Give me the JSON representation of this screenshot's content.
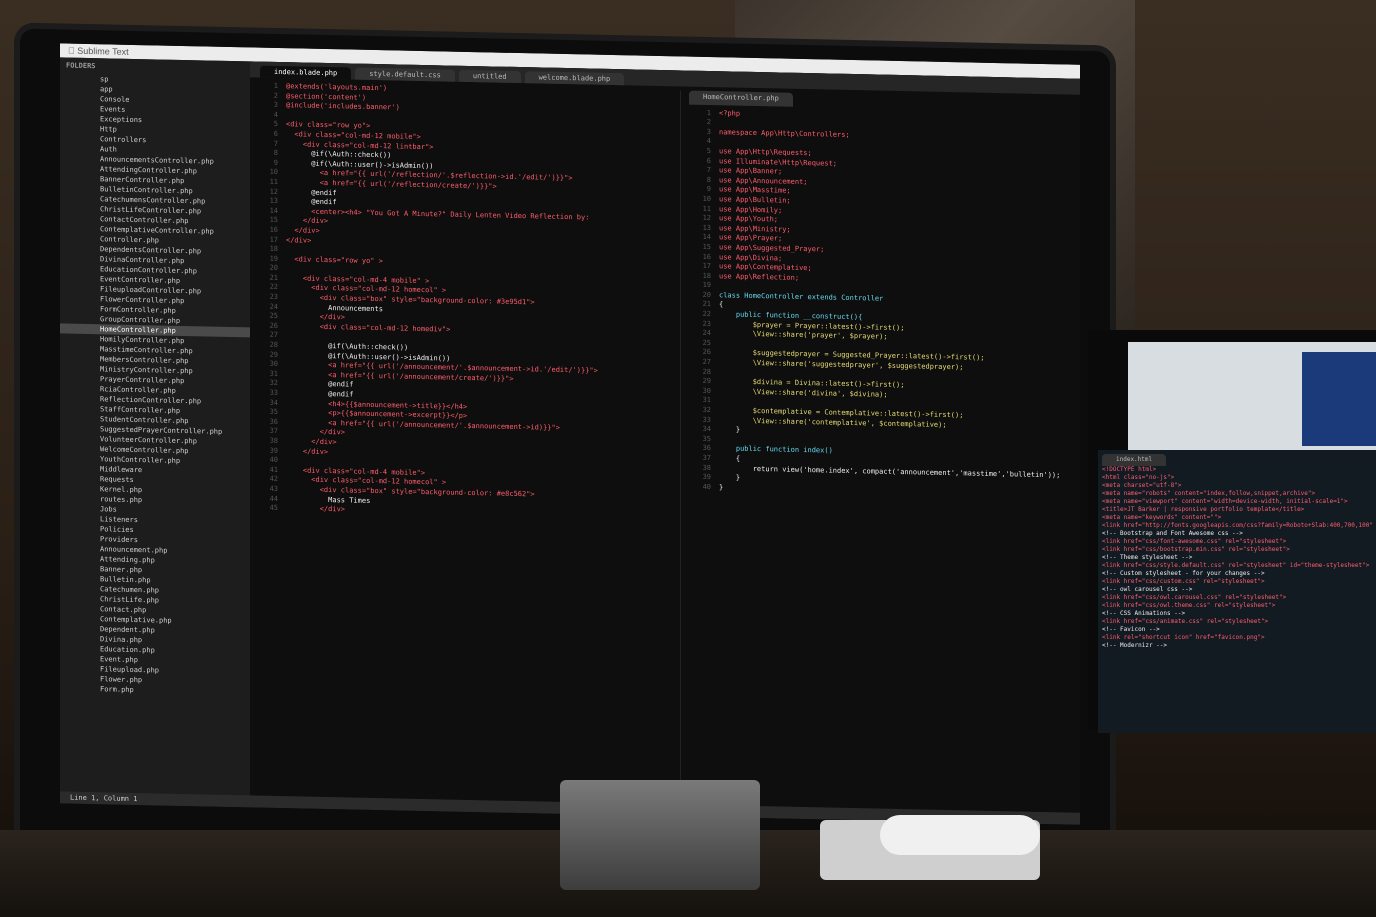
{
  "app": {
    "name": "Sublime Text",
    "menubar_label": "Sublime Text",
    "sidebar_header": "FOLDERS",
    "sidebar_items": [
      "sp",
      "app",
      "Console",
      "Events",
      "Exceptions",
      "Http",
      "Controllers",
      "Auth",
      "AnnouncementsController.php",
      "AttendingController.php",
      "BannerController.php",
      "BulletinController.php",
      "CatechumensController.php",
      "ChristLifeController.php",
      "ContactController.php",
      "ContemplativeController.php",
      "Controller.php",
      "DependentsController.php",
      "DivinaController.php",
      "EducationController.php",
      "EventController.php",
      "FileuploadController.php",
      "FlowerController.php",
      "FormController.php",
      "GroupController.php",
      "HomeController.php",
      "HomilyController.php",
      "MasstimeController.php",
      "MembersController.php",
      "MinistryController.php",
      "PrayerController.php",
      "RciaController.php",
      "ReflectionController.php",
      "StaffController.php",
      "StudentController.php",
      "SuggestedPrayerController.php",
      "VolunteerController.php",
      "WelcomeController.php",
      "YouthController.php",
      "Middleware",
      "Requests",
      "Kernel.php",
      "routes.php",
      "Jobs",
      "Listeners",
      "Policies",
      "Providers",
      "Announcement.php",
      "Attending.php",
      "Banner.php",
      "Bulletin.php",
      "Catechumen.php",
      "ChristLife.php",
      "Contact.php",
      "Contemplative.php",
      "Dependent.php",
      "Divina.php",
      "Education.php",
      "Event.php",
      "Fileupload.php",
      "Flower.php",
      "Form.php"
    ],
    "selected_sidebar_item": "HomeController.php",
    "tabs": [
      "index.blade.php",
      "style.default.css",
      "untitled",
      "welcome.blade.php"
    ],
    "active_tab": "index.blade.php",
    "secondary_tab": "HomeController.php",
    "status_text": "Line 1, Column 1"
  },
  "code_left": [
    {
      "n": "1",
      "text": "@extends('layouts.main')"
    },
    {
      "n": "2",
      "text": "@section('content')"
    },
    {
      "n": "3",
      "text": "@include('includes.banner')"
    },
    {
      "n": "4",
      "text": ""
    },
    {
      "n": "5",
      "text": "<div class=\"row yo\">"
    },
    {
      "n": "6",
      "text": "  <div class=\"col-md-12 mobile\">"
    },
    {
      "n": "7",
      "text": "    <div class=\"col-md-12 lintbar\">"
    },
    {
      "n": "8",
      "text": "      @if(\\Auth::check())"
    },
    {
      "n": "9",
      "text": "      @if(\\Auth::user()->isAdmin())"
    },
    {
      "n": "10",
      "text": "        <a href=\"{{ url('/reflection/'.$reflection->id.'/edit/')}}\">"
    },
    {
      "n": "11",
      "text": "        <a href=\"{{ url('/reflection/create/')}}\">"
    },
    {
      "n": "12",
      "text": "      @endif"
    },
    {
      "n": "13",
      "text": "      @endif"
    },
    {
      "n": "14",
      "text": "      <center><h4> \"You Got A Minute?\" Daily Lenten Video Reflection by:"
    },
    {
      "n": "15",
      "text": "    </div>"
    },
    {
      "n": "16",
      "text": "  </div>"
    },
    {
      "n": "17",
      "text": "</div>"
    },
    {
      "n": "18",
      "text": ""
    },
    {
      "n": "19",
      "text": "  <div class=\"row yo\" >"
    },
    {
      "n": "20",
      "text": ""
    },
    {
      "n": "21",
      "text": "    <div class=\"col-md-4 mobile\" >"
    },
    {
      "n": "22",
      "text": "      <div class=\"col-md-12 homecol\" >"
    },
    {
      "n": "23",
      "text": "        <div class=\"box\" style=\"background-color: #3e95d1\">"
    },
    {
      "n": "24",
      "text": "          Announcements"
    },
    {
      "n": "25",
      "text": "        </div>"
    },
    {
      "n": "26",
      "text": "        <div class=\"col-md-12 homediv\">"
    },
    {
      "n": "27",
      "text": ""
    },
    {
      "n": "28",
      "text": "          @if(\\Auth::check())"
    },
    {
      "n": "29",
      "text": "          @if(\\Auth::user()->isAdmin())"
    },
    {
      "n": "30",
      "text": "          <a href=\"{{ url('/announcement/'.$announcement->id.'/edit/')}}\">"
    },
    {
      "n": "31",
      "text": "          <a href=\"{{ url('/announcement/create/')}}\">"
    },
    {
      "n": "32",
      "text": "          @endif"
    },
    {
      "n": "33",
      "text": "          @endif"
    },
    {
      "n": "34",
      "text": "          <h4>{{$announcement->title}}</h4>"
    },
    {
      "n": "35",
      "text": "          <p>{{$announcement->excerpt}}</p>"
    },
    {
      "n": "36",
      "text": "          <a href=\"{{ url('/announcement/'.$announcement->id)}}\">"
    },
    {
      "n": "37",
      "text": "        </div>"
    },
    {
      "n": "38",
      "text": "      </div>"
    },
    {
      "n": "39",
      "text": "    </div>"
    },
    {
      "n": "40",
      "text": ""
    },
    {
      "n": "41",
      "text": "    <div class=\"col-md-4 mobile\">"
    },
    {
      "n": "42",
      "text": "      <div class=\"col-md-12 homecol\" >"
    },
    {
      "n": "43",
      "text": "        <div class=\"box\" style=\"background-color: #e8c562\">"
    },
    {
      "n": "44",
      "text": "          Mass Times"
    },
    {
      "n": "45",
      "text": "        </div>"
    }
  ],
  "code_right": [
    {
      "n": "1",
      "text": "<?php"
    },
    {
      "n": "2",
      "text": ""
    },
    {
      "n": "3",
      "text": "namespace App\\Http\\Controllers;"
    },
    {
      "n": "4",
      "text": ""
    },
    {
      "n": "5",
      "text": "use App\\Http\\Requests;"
    },
    {
      "n": "6",
      "text": "use Illuminate\\Http\\Request;"
    },
    {
      "n": "7",
      "text": "use App\\Banner;"
    },
    {
      "n": "8",
      "text": "use App\\Announcement;"
    },
    {
      "n": "9",
      "text": "use App\\Masstime;"
    },
    {
      "n": "10",
      "text": "use App\\Bulletin;"
    },
    {
      "n": "11",
      "text": "use App\\Homily;"
    },
    {
      "n": "12",
      "text": "use App\\Youth;"
    },
    {
      "n": "13",
      "text": "use App\\Ministry;"
    },
    {
      "n": "14",
      "text": "use App\\Prayer;"
    },
    {
      "n": "15",
      "text": "use App\\Suggested_Prayer;"
    },
    {
      "n": "16",
      "text": "use App\\Divina;"
    },
    {
      "n": "17",
      "text": "use App\\Contemplative;"
    },
    {
      "n": "18",
      "text": "use App\\Reflection;"
    },
    {
      "n": "19",
      "text": ""
    },
    {
      "n": "20",
      "text": "class HomeController extends Controller"
    },
    {
      "n": "21",
      "text": "{"
    },
    {
      "n": "22",
      "text": "    public function __construct(){"
    },
    {
      "n": "23",
      "text": "        $prayer = Prayer::latest()->first();"
    },
    {
      "n": "24",
      "text": "        \\View::share('prayer', $prayer);"
    },
    {
      "n": "25",
      "text": ""
    },
    {
      "n": "26",
      "text": "        $suggestedprayer = Suggested_Prayer::latest()->first();"
    },
    {
      "n": "27",
      "text": "        \\View::share('suggestedprayer', $suggestedprayer);"
    },
    {
      "n": "28",
      "text": ""
    },
    {
      "n": "29",
      "text": "        $divina = Divina::latest()->first();"
    },
    {
      "n": "30",
      "text": "        \\View::share('divina', $divina);"
    },
    {
      "n": "31",
      "text": ""
    },
    {
      "n": "32",
      "text": "        $contemplative = Contemplative::latest()->first();"
    },
    {
      "n": "33",
      "text": "        \\View::share('contemplative', $contemplative);"
    },
    {
      "n": "34",
      "text": "    }"
    },
    {
      "n": "35",
      "text": ""
    },
    {
      "n": "36",
      "text": "    public function index()"
    },
    {
      "n": "37",
      "text": "    {"
    },
    {
      "n": "38",
      "text": "        return view('home.index', compact('announcement','masstime','bulletin'));"
    },
    {
      "n": "39",
      "text": "    }"
    },
    {
      "n": "40",
      "text": "}"
    }
  ],
  "side_monitor": {
    "tab": "index.html",
    "lines": [
      "<!DOCTYPE html>",
      "<html class=\"no-js\">",
      "<meta charset=\"utf-8\">",
      "<meta name=\"robots\" content=\"index,follow,snippet,archive\">",
      "<meta name=\"viewport\" content=\"width=device-width, initial-scale=1\">",
      "<title>JT Barker | responsive portfolio template</title>",
      "<meta name=\"keywords\" content=\"\">",
      "<link href=\"http://fonts.googleapis.com/css?family=Roboto+Slab:400,700,100\"",
      "<!-- Bootstrap and Font Awesome css -->",
      "<link href=\"css/font-awesome.css\" rel=\"stylesheet\">",
      "<link href=\"css/bootstrap.min.css\" rel=\"stylesheet\">",
      "<!-- Theme stylesheet -->",
      "<link href=\"css/style.default.css\" rel=\"stylesheet\" id=\"theme-stylesheet\">",
      "<!-- Custom stylesheet - for your changes -->",
      "<link href=\"css/custom.css\" rel=\"stylesheet\">",
      "<!-- owl carousel css -->",
      "<link href=\"css/owl.carousel.css\" rel=\"stylesheet\">",
      "<link href=\"css/owl.theme.css\" rel=\"stylesheet\">",
      "<!-- CSS Animations -->",
      "<link href=\"css/animate.css\" rel=\"stylesheet\">",
      "<!-- Favicon -->",
      "<link rel=\"shortcut icon\" href=\"favicon.png\">",
      "<!-- Modernizr -->"
    ]
  }
}
